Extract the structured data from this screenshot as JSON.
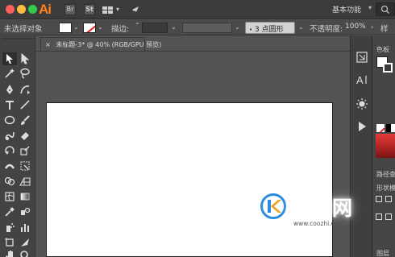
{
  "app": {
    "logo_text": "Ai",
    "br_label": "Br",
    "st_label": "St",
    "workspace_label": "基本功能",
    "workspace_chevron": "▾"
  },
  "controlbar": {
    "selection_status": "未选择对象",
    "stroke_label": "描边:",
    "brush_profile": "3 点圆形",
    "opacity_label": "不透明度:",
    "opacity_value": "100%",
    "chevron": "⌄",
    "up_down": "⌃"
  },
  "document": {
    "tab_title": "未标题-3* @ 40% (RGB/GPU 预览)",
    "close_glyph": "×"
  },
  "right_panels": {
    "color_label": "色板",
    "pathfinder_label": "路径查",
    "shape_label": "形状模",
    "layers_label": "图层",
    "side_chevron": "》",
    "more_label": "样"
  },
  "watermark": {
    "brand": "酷知网",
    "url": "www.coozhi.com"
  },
  "colors": {
    "accent_orange": "#ff7f18",
    "traffic_red": "#fc605c",
    "traffic_yellow": "#fdbc40",
    "traffic_green": "#34c84a",
    "watermark_blue": "#2a8ce0"
  },
  "icons": {
    "tools": [
      "selection-tool-icon",
      "direct-selection-tool-icon",
      "magic-wand-icon",
      "lasso-icon",
      "pen-tool-icon",
      "curvature-tool-icon",
      "type-tool-icon",
      "line-tool-icon",
      "ellipse-tool-icon",
      "paintbrush-icon",
      "shaper-tool-icon",
      "eraser-icon",
      "rotate-tool-icon",
      "scale-tool-icon",
      "width-tool-icon",
      "free-transform-icon",
      "shape-builder-icon",
      "perspective-grid-icon",
      "mesh-tool-icon",
      "gradient-tool-icon",
      "eyedropper-icon",
      "blend-tool-icon",
      "symbol-sprayer-icon",
      "column-graph-icon",
      "artboard-tool-icon",
      "slice-tool-icon",
      "hand-tool-icon",
      "zoom-tool-icon"
    ]
  }
}
